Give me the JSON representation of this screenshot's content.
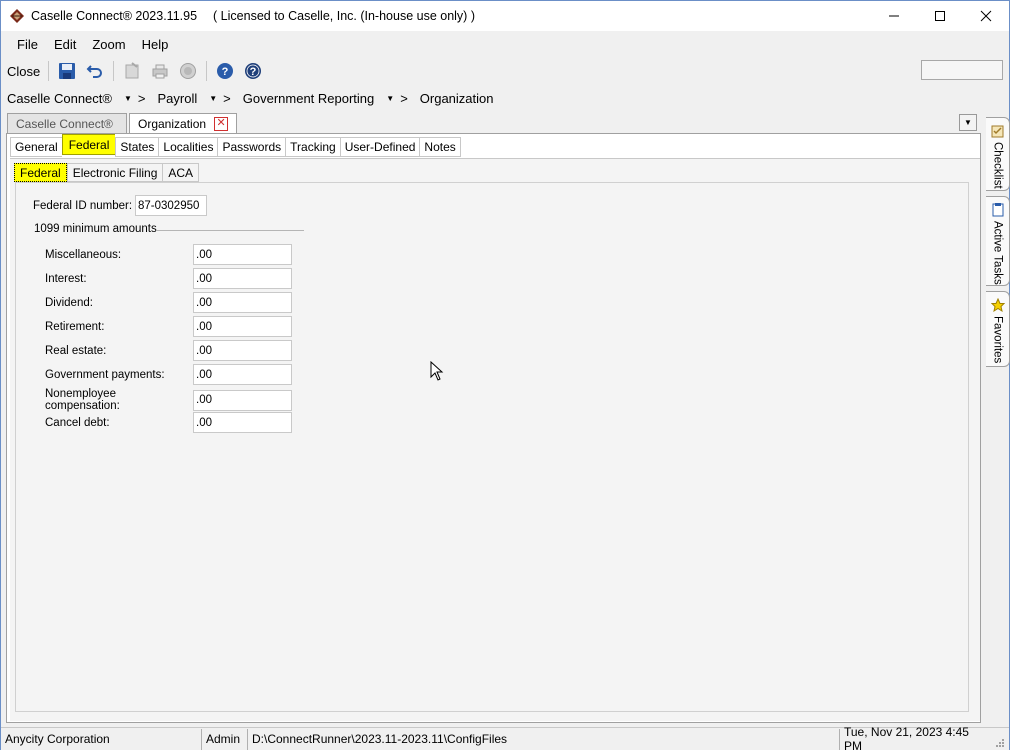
{
  "window": {
    "title": "Caselle Connect® 2023.11.95",
    "license": "( Licensed to Caselle, Inc. (In-house use only) )"
  },
  "menu": [
    "File",
    "Edit",
    "Zoom",
    "Help"
  ],
  "toolbar": {
    "close_label": "Close"
  },
  "breadcrumb": {
    "items": [
      "Caselle Connect®",
      "Payroll",
      "Government Reporting",
      "Organization"
    ]
  },
  "doc_tabs": [
    {
      "label": "Caselle Connect®"
    },
    {
      "label": "Organization"
    }
  ],
  "section_tabs": [
    "General",
    "Federal",
    "States",
    "Localities",
    "Passwords",
    "Tracking",
    "User-Defined",
    "Notes"
  ],
  "sub_tabs": [
    "Federal",
    "Electronic Filing",
    "ACA"
  ],
  "form": {
    "federal_id_label": "Federal ID number:",
    "federal_id_value": "87-0302950",
    "group_label": "1099 minimum amounts",
    "fields": [
      {
        "label": "Miscellaneous:",
        "value": ".00"
      },
      {
        "label": "Interest:",
        "value": ".00"
      },
      {
        "label": "Dividend:",
        "value": ".00"
      },
      {
        "label": "Retirement:",
        "value": ".00"
      },
      {
        "label": "Real estate:",
        "value": ".00"
      },
      {
        "label": "Government payments:",
        "value": ".00"
      },
      {
        "label": "Nonemployee compensation:",
        "value": ".00"
      },
      {
        "label": "Cancel debt:",
        "value": ".00"
      }
    ]
  },
  "side_tabs": [
    "Checklist",
    "Active Tasks",
    "Favorites"
  ],
  "status": {
    "organization": "Anycity Corporation",
    "user": "Admin",
    "path": "D:\\ConnectRunner\\2023.11-2023.11\\ConfigFiles",
    "datetime": "Tue, Nov 21, 2023 4:45 PM"
  },
  "colors": {
    "highlight": "#ffff00",
    "accent_blue": "#2a5caa"
  }
}
